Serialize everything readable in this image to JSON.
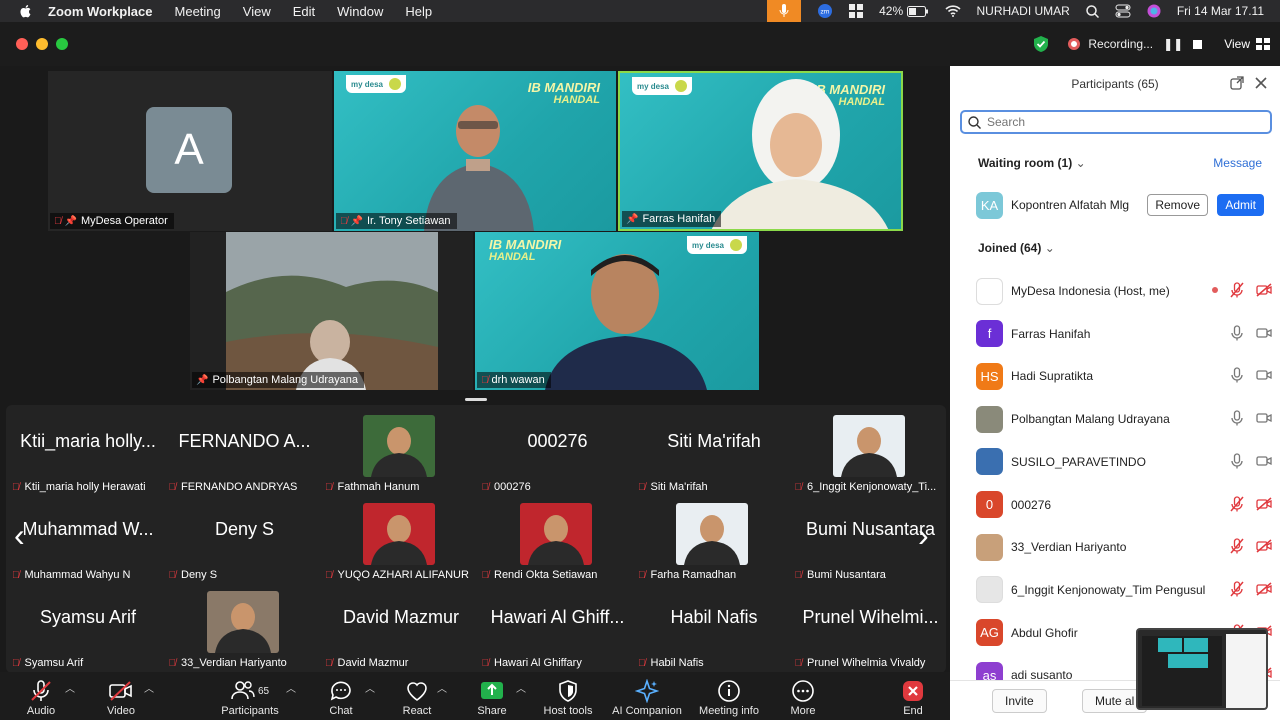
{
  "menubar": {
    "app": "Zoom Workplace",
    "items": [
      "Meeting",
      "View",
      "Edit",
      "Window",
      "Help"
    ],
    "battery": "42%",
    "user": "NURHADI UMAR",
    "datetime": "Fri 14 Mar  17.11"
  },
  "titlebar": {
    "recording": "Recording...",
    "view": "View"
  },
  "colors": {
    "accent": "#1d6df2",
    "active_border": "#8bd94a",
    "mute": "#e0393e",
    "recording": "#e25c5c"
  },
  "speakers": [
    {
      "name": "MyDesa Operator",
      "initial": "A"
    },
    {
      "name": "Ir. Tony Setiawan",
      "banner": "IB MANDIRI",
      "banner_sub": "HANDAL"
    },
    {
      "name": "Farras Hanifah",
      "banner": "IB MANDIRI",
      "banner_sub": "HANDAL"
    },
    {
      "name": "Polbangtan Malang Udrayana"
    },
    {
      "name": "drh wawan",
      "banner": "IB MANDIRI",
      "banner_sub": "HANDAL"
    }
  ],
  "logo": {
    "text": "my desa"
  },
  "gallery": [
    {
      "big": "Ktii_maria holly...",
      "label": "Ktii_maria holly Herawati"
    },
    {
      "big": "FERNANDO A...",
      "label": "FERNANDO ANDRYAS"
    },
    {
      "big": "",
      "label": "Fathmah Hanum"
    },
    {
      "big": "000276",
      "label": "000276"
    },
    {
      "big": "Siti Ma'rifah",
      "label": "Siti Ma'rifah"
    },
    {
      "big": "",
      "label": "6_Inggit Kenjonowaty_Ti..."
    },
    {
      "big": "Muhammad W...",
      "label": "Muhammad Wahyu N"
    },
    {
      "big": "Deny S",
      "label": "Deny S"
    },
    {
      "big": "",
      "label": "YUQO AZHARI ALIFANUR"
    },
    {
      "big": "",
      "label": "Rendi Okta Setiawan"
    },
    {
      "big": "",
      "label": "Farha Ramadhan"
    },
    {
      "big": "Bumi Nusantara",
      "label": "Bumi Nusantara"
    },
    {
      "big": "Syamsu Arif",
      "label": "Syamsu Arif"
    },
    {
      "big": "",
      "label": "33_Verdian Hariyanto"
    },
    {
      "big": "David Mazmur",
      "label": "David Mazmur"
    },
    {
      "big": "Hawari Al Ghiff...",
      "label": "Hawari Al Ghiffary"
    },
    {
      "big": "Habil Nafis",
      "label": "Habil Nafis"
    },
    {
      "big": "Prunel Wihelmi...",
      "label": "Prunel Wihelmia Vivaldy"
    }
  ],
  "toolbar": {
    "audio": "Audio",
    "video": "Video",
    "participants": "Participants",
    "participants_count": "65",
    "chat": "Chat",
    "react": "React",
    "share": "Share",
    "host_tools": "Host tools",
    "ai_companion": "AI Companion",
    "meeting_info": "Meeting info",
    "more": "More",
    "end": "End"
  },
  "panel": {
    "title": "Participants (65)",
    "search_placeholder": "Search",
    "waiting_room": "Waiting room (1)",
    "message": "Message",
    "waiting": {
      "initials": "KA",
      "name": "Kopontren  Alfatah Mlg",
      "remove": "Remove",
      "admit": "Admit"
    },
    "joined": "Joined (64)",
    "participants": [
      {
        "initials": "",
        "name": "MyDesa Indonesia (Host, me)",
        "color": "#ffffff",
        "muted": true
      },
      {
        "initials": "f",
        "name": "Farras Hanifah",
        "color": "#6b2fd6",
        "muted": false
      },
      {
        "initials": "HS",
        "name": "Hadi Supratikta",
        "color": "#f07a17",
        "muted": false
      },
      {
        "initials": "",
        "name": "Polbangtan Malang Udrayana",
        "color": "#8a8a7a",
        "muted": false
      },
      {
        "initials": "",
        "name": "SUSILO_PARAVETINDO",
        "color": "#3a6fb0",
        "muted": false
      },
      {
        "initials": "0",
        "name": "000276",
        "color": "#d9472b",
        "muted": true
      },
      {
        "initials": "",
        "name": "33_Verdian Hariyanto",
        "color": "#c8a07a",
        "muted": true
      },
      {
        "initials": "",
        "name": "6_Inggit Kenjonowaty_Tim Pengusul",
        "color": "#e6e6e6",
        "muted": true
      },
      {
        "initials": "AG",
        "name": "Abdul Ghofir",
        "color": "#d9472b",
        "muted": true
      },
      {
        "initials": "as",
        "name": "adi susanto",
        "color": "#8e3fd0",
        "muted": true
      }
    ],
    "invite": "Invite",
    "mute_all": "Mute al"
  }
}
